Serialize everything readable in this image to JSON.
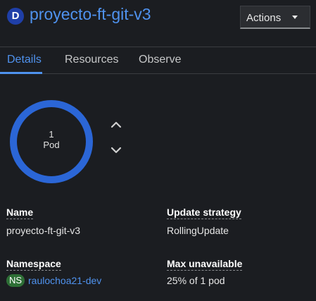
{
  "header": {
    "resource_badge": "D",
    "title": "proyecto-ft-git-v3",
    "actions_label": "Actions"
  },
  "tabs": [
    {
      "label": "Details",
      "active": true
    },
    {
      "label": "Resources",
      "active": false
    },
    {
      "label": "Observe",
      "active": false
    }
  ],
  "pod_ring": {
    "count": "1",
    "label": "Pod",
    "ring_color": "#2b66d6"
  },
  "scale_controls": {
    "up_icon": "chevron-up-icon",
    "down_icon": "chevron-down-icon"
  },
  "details": {
    "name": {
      "label": "Name",
      "value": "proyecto-ft-git-v3"
    },
    "update_strategy": {
      "label": "Update strategy",
      "value": "RollingUpdate"
    },
    "namespace": {
      "label": "Namespace",
      "badge": "NS",
      "value": "raulochoa21-dev"
    },
    "max_unavailable": {
      "label": "Max unavailable",
      "value": "25% of 1 pod"
    }
  },
  "colors": {
    "accent": "#4f92ee",
    "background": "#1b1d21",
    "ns_badge": "#2e6f36",
    "resource_badge": "#1f3fa8"
  }
}
